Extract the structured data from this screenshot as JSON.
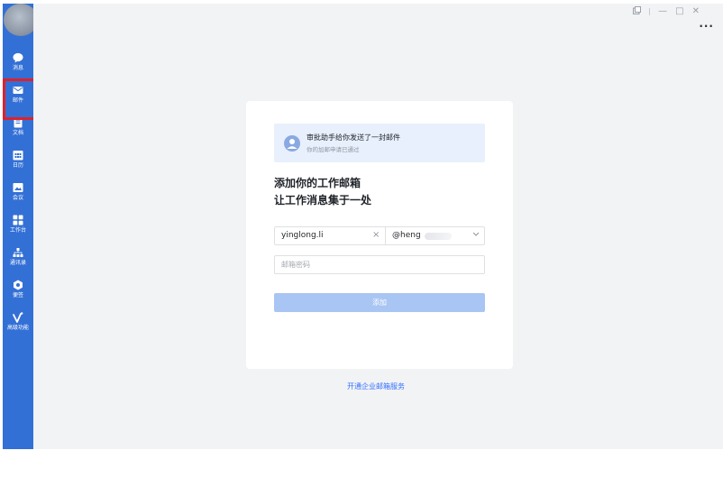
{
  "sidebar": {
    "items": [
      {
        "label": "消息",
        "icon": "chat-bubble-icon"
      },
      {
        "label": "邮件",
        "icon": "mail-icon"
      },
      {
        "label": "文档",
        "icon": "document-icon"
      },
      {
        "label": "日历",
        "icon": "calendar-icon"
      },
      {
        "label": "会议",
        "icon": "meeting-icon"
      },
      {
        "label": "工作台",
        "icon": "workplace-grid-icon"
      },
      {
        "label": "通讯录",
        "icon": "contacts-org-icon"
      },
      {
        "label": "便签",
        "icon": "notes-icon"
      },
      {
        "label": "高级功能",
        "icon": "advanced-feature-icon"
      }
    ],
    "active_index": 1,
    "bg_color": "#3370d6"
  },
  "window": {
    "pin_icon": "pin-icon",
    "minimize": "—",
    "maximize": "□",
    "close": "✕",
    "more": "···"
  },
  "card": {
    "notice": {
      "title": "审批助手给你发送了一封邮件",
      "subtitle": "你的加邮申请已通过"
    },
    "heading_line1": "添加你的工作邮箱",
    "heading_line2": "让工作消息集于一处",
    "email_user": "yinglong.li",
    "email_domain": "@heng",
    "clear": "×",
    "password_placeholder": "邮箱密码",
    "add_button": "添加"
  },
  "footer_link": "开通企业邮箱服务",
  "colors": {
    "accent": "#3370ff",
    "button_disabled": "#a9c5f3",
    "highlight_box": "#e0202a"
  }
}
